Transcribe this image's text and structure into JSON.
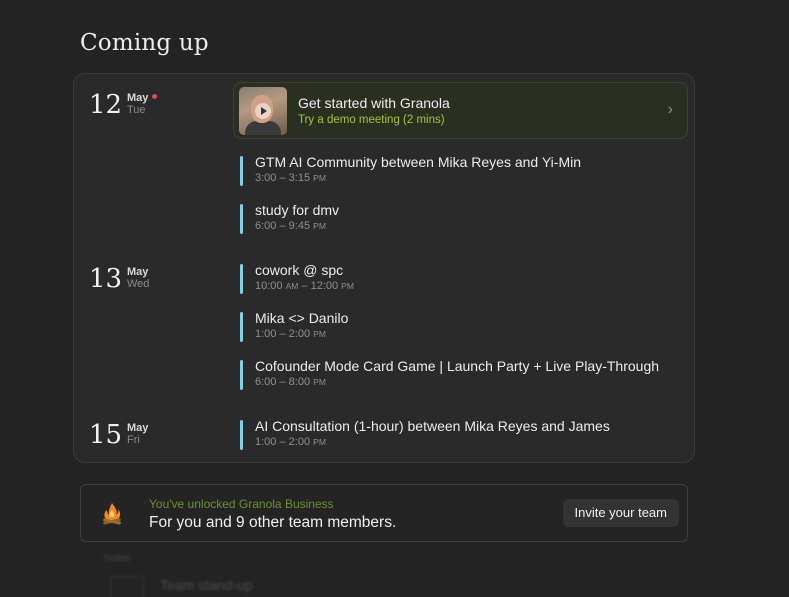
{
  "header": {
    "title": "Coming up"
  },
  "days": [
    {
      "num": "12",
      "month": "May",
      "weekday": "Tue",
      "today": true
    },
    {
      "num": "13",
      "month": "May",
      "weekday": "Wed"
    },
    {
      "num": "15",
      "month": "May",
      "weekday": "Fri"
    }
  ],
  "demo": {
    "title": "Get started with Granola",
    "subtitle": "Try a demo meeting (2 mins)",
    "chevron": "›",
    "icon": "play-icon"
  },
  "events": [
    {
      "title": "GTM AI Community between Mika Reyes and Yi-Min",
      "start": "3:00",
      "start_ampm": "",
      "end": "3:15",
      "end_ampm": "PM"
    },
    {
      "title": "study for dmv",
      "start": "6:00",
      "start_ampm": "",
      "end": "9:45",
      "end_ampm": "PM"
    },
    {
      "title": "cowork @ spc",
      "start": "10:00",
      "start_ampm": "AM",
      "end": "12:00",
      "end_ampm": "PM"
    },
    {
      "title": "Mika <> Danilo",
      "start": "1:00",
      "start_ampm": "",
      "end": "2:00",
      "end_ampm": "PM"
    },
    {
      "title": "Cofounder Mode Card Game | Launch Party + Live Play-Through",
      "start": "6:00",
      "start_ampm": "",
      "end": "8:00",
      "end_ampm": "PM"
    },
    {
      "title": "AI Consultation (1-hour) between Mika Reyes and James",
      "start": "1:00",
      "start_ampm": "",
      "end": "2:00",
      "end_ampm": "PM"
    }
  ],
  "business": {
    "headline": "You've unlocked Granola Business",
    "body": "For you and 9 other team members.",
    "invite_label": "Invite your team",
    "icon": "campfire-icon"
  },
  "faded_next": {
    "section_label": "Notes",
    "item_title": "Team stand-up"
  },
  "colors": {
    "background": "#232323",
    "event_bar": "#7fd0e8",
    "demo_accent": "#a6c23a",
    "today_dot": "#e5484d",
    "business_accent": "#6f8f2a"
  }
}
